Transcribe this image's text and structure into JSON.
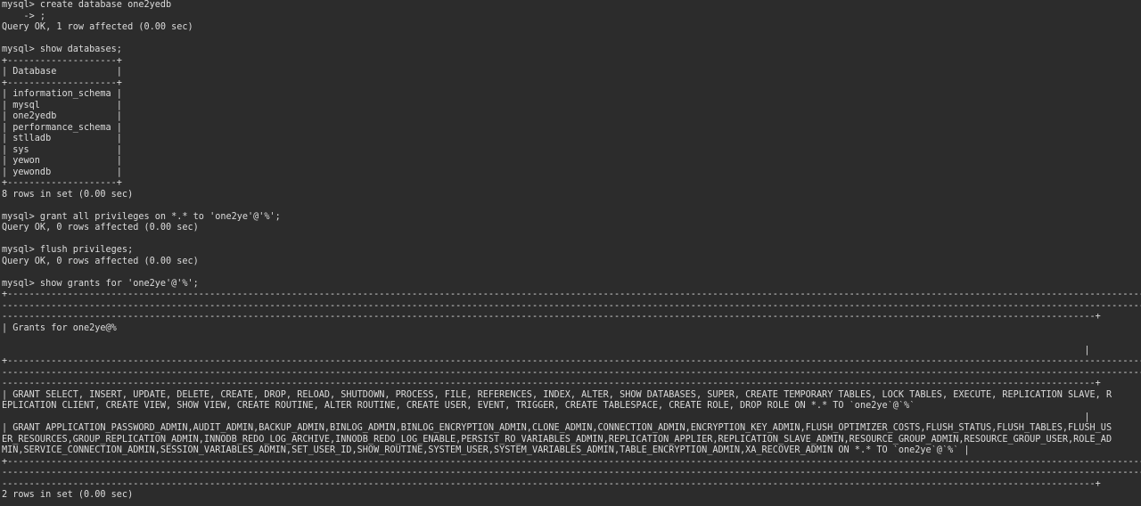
{
  "terminal": {
    "lines": [
      "mysql> create database one2yedb",
      "    -> ;",
      "Query OK, 1 row affected (0.00 sec)",
      "",
      "mysql> show databases;",
      "+--------------------+",
      "| Database           |",
      "+--------------------+",
      "| information_schema |",
      "| mysql              |",
      "| one2yedb           |",
      "| performance_schema |",
      "| stlladb            |",
      "| sys                |",
      "| yewon              |",
      "| yewondb            |",
      "+--------------------+",
      "8 rows in set (0.00 sec)",
      "",
      "mysql> grant all privileges on *.* to 'one2ye'@'%';",
      "Query OK, 0 rows affected (0.00 sec)",
      "",
      "mysql> flush privileges;",
      "Query OK, 0 rows affected (0.00 sec)",
      "",
      "mysql> show grants for 'one2ye'@'%';",
      "+--------------------------------------------------------------------------------------------------------------------------------------------------------------------------------------------------------------------------------------",
      "---------------------------------------------------------------------------------------------------------------------------------------------------------------------------------------------------------------------------------------",
      "--------------------------------------------------------------------------------------------------------------------------------------------------------------------------------------------------------+",
      "| Grants for one2ye@%",
      "",
      "                                                                                                                                                                                                      |",
      "+--------------------------------------------------------------------------------------------------------------------------------------------------------------------------------------------------------------------------------------",
      "---------------------------------------------------------------------------------------------------------------------------------------------------------------------------------------------------------------------------------------",
      "--------------------------------------------------------------------------------------------------------------------------------------------------------------------------------------------------------+",
      "| GRANT SELECT, INSERT, UPDATE, DELETE, CREATE, DROP, RELOAD, SHUTDOWN, PROCESS, FILE, REFERENCES, INDEX, ALTER, SHOW DATABASES, SUPER, CREATE TEMPORARY TABLES, LOCK TABLES, EXECUTE, REPLICATION SLAVE, R",
      "EPLICATION CLIENT, CREATE VIEW, SHOW VIEW, CREATE ROUTINE, ALTER ROUTINE, CREATE USER, EVENT, TRIGGER, CREATE TABLESPACE, CREATE ROLE, DROP ROLE ON *.* TO `one2ye`@`%`",
      "                                                                                                                                                                                                      |",
      "| GRANT APPLICATION_PASSWORD_ADMIN,AUDIT_ADMIN,BACKUP_ADMIN,BINLOG_ADMIN,BINLOG_ENCRYPTION_ADMIN,CLONE_ADMIN,CONNECTION_ADMIN,ENCRYPTION_KEY_ADMIN,FLUSH_OPTIMIZER_COSTS,FLUSH_STATUS,FLUSH_TABLES,FLUSH_US",
      "ER_RESOURCES,GROUP_REPLICATION_ADMIN,INNODB_REDO_LOG_ARCHIVE,INNODB_REDO_LOG_ENABLE,PERSIST_RO_VARIABLES_ADMIN,REPLICATION_APPLIER,REPLICATION_SLAVE_ADMIN,RESOURCE_GROUP_ADMIN,RESOURCE_GROUP_USER,ROLE_AD",
      "MIN,SERVICE_CONNECTION_ADMIN,SESSION_VARIABLES_ADMIN,SET_USER_ID,SHOW_ROUTINE,SYSTEM_USER,SYSTEM_VARIABLES_ADMIN,TABLE_ENCRYPTION_ADMIN,XA_RECOVER_ADMIN ON *.* TO `one2ye`@`%` |",
      "+--------------------------------------------------------------------------------------------------------------------------------------------------------------------------------------------------------------------------------------",
      "---------------------------------------------------------------------------------------------------------------------------------------------------------------------------------------------------------------------------------------",
      "--------------------------------------------------------------------------------------------------------------------------------------------------------------------------------------------------------+",
      "2 rows in set (0.00 sec)"
    ]
  },
  "colors": {
    "background": "#2c2c2c",
    "text": "#dcdcdc"
  }
}
